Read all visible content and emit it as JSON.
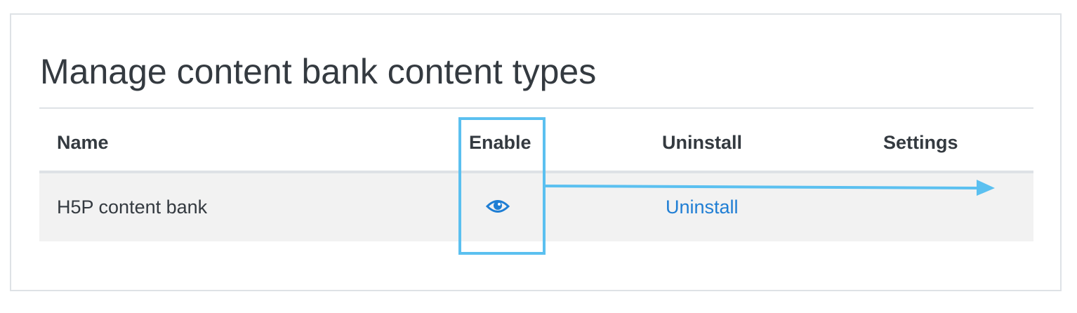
{
  "page": {
    "title": "Manage content bank content types"
  },
  "table": {
    "headers": {
      "name": "Name",
      "enable": "Enable",
      "uninstall": "Uninstall",
      "settings": "Settings"
    },
    "rows": [
      {
        "name": "H5P content bank",
        "enable_icon": "eye-icon",
        "uninstall_label": "Uninstall",
        "settings": ""
      }
    ]
  },
  "colors": {
    "link": "#1f7ed4",
    "highlight": "#5bc0f0",
    "row_background": "#f2f2f2",
    "border": "#dee2e6",
    "text": "#343a40"
  }
}
